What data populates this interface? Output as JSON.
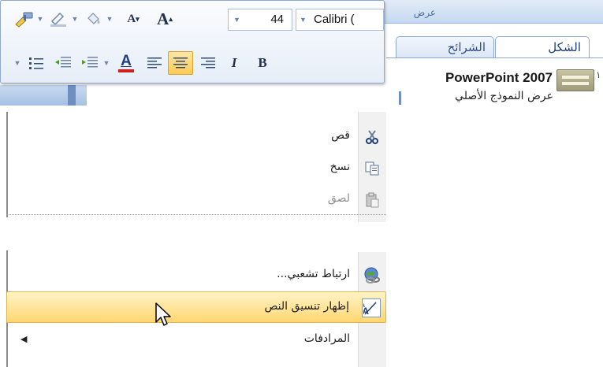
{
  "background_window": {
    "view_title_fragment": "عرض",
    "tabs": [
      {
        "label": "الشرائح"
      },
      {
        "label": "الشكل"
      }
    ],
    "outline": {
      "slide_number": "١",
      "title": "PowerPoint 2007",
      "subtitle": "عرض النموذج الأصلي"
    }
  },
  "mini_toolbar": {
    "font_name": "Calibri (",
    "font_size": "44",
    "row1_buttons": [
      "format-painter",
      "line-color",
      "fill-color",
      "shrink-font",
      "grow-font"
    ],
    "row2_buttons": [
      "bullets",
      "decrease-indent",
      "increase-indent",
      "font-color",
      "align-left",
      "align-center",
      "align-right",
      "italic",
      "bold"
    ],
    "labels": {
      "shrink": "A",
      "grow": "A",
      "font_color": "A",
      "italic": "I",
      "bold": "B"
    },
    "active_button": "align-center",
    "accent_color": "#ffcb55"
  },
  "context_menu": {
    "group1": [
      {
        "label": "قص",
        "icon": "scissors-icon",
        "enabled": true
      },
      {
        "label": "نسخ",
        "icon": "copy-icon",
        "enabled": true
      },
      {
        "label": "لصق",
        "icon": "paste-icon",
        "enabled": false
      }
    ],
    "group2": [
      {
        "label": "ارتباط تشعبي...",
        "icon": "hyperlink-globe-icon",
        "enabled": true
      },
      {
        "label": "إظهار تنسيق النص",
        "icon": "text-formatting-icon",
        "enabled": true,
        "highlighted": true
      },
      {
        "label": "المرادفات",
        "icon": "",
        "enabled": true,
        "has_submenu": true
      }
    ],
    "highlight_color": "#ffd772"
  }
}
